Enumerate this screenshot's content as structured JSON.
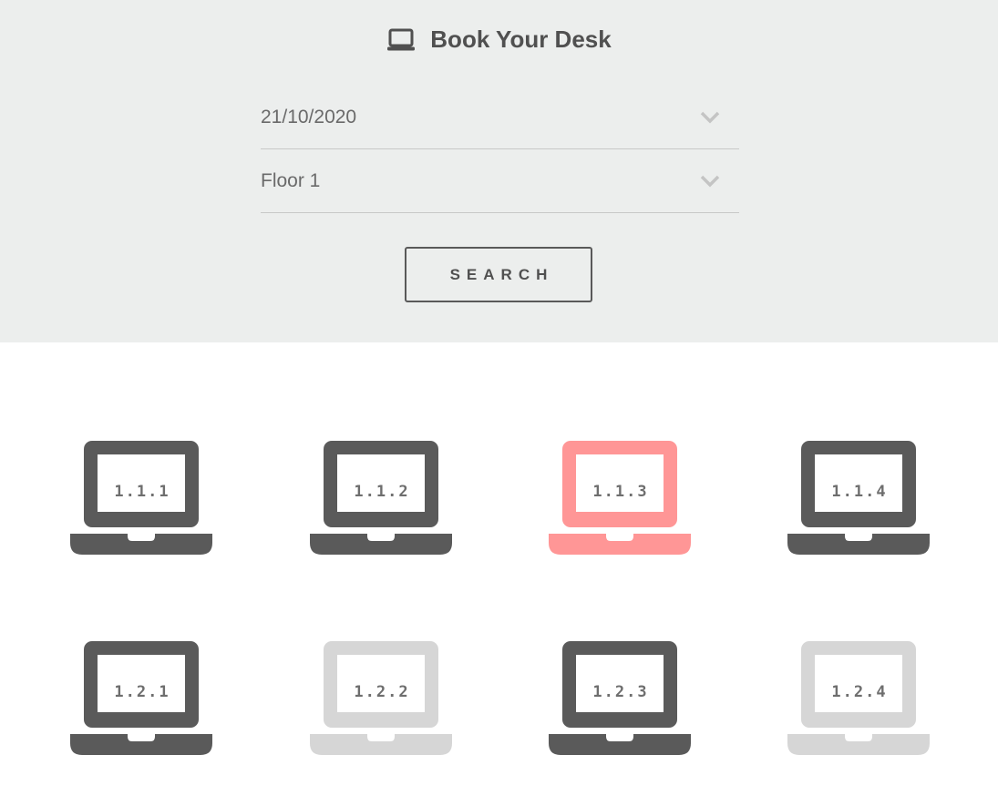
{
  "header": {
    "title": "Book Your Desk",
    "title_icon": "laptop-icon"
  },
  "form": {
    "date_value": "21/10/2020",
    "floor_value": "Floor 1",
    "search_label": "SEARCH"
  },
  "colors": {
    "available": "#5a5a5a",
    "selected": "#ff9696",
    "unavailable": "#d6d6d6",
    "header_bg": "#eceeed"
  },
  "desks": [
    {
      "id": "1.1.1",
      "status": "available"
    },
    {
      "id": "1.1.2",
      "status": "available"
    },
    {
      "id": "1.1.3",
      "status": "selected"
    },
    {
      "id": "1.1.4",
      "status": "available"
    },
    {
      "id": "1.2.1",
      "status": "available"
    },
    {
      "id": "1.2.2",
      "status": "unavailable"
    },
    {
      "id": "1.2.3",
      "status": "available"
    },
    {
      "id": "1.2.4",
      "status": "unavailable"
    }
  ]
}
